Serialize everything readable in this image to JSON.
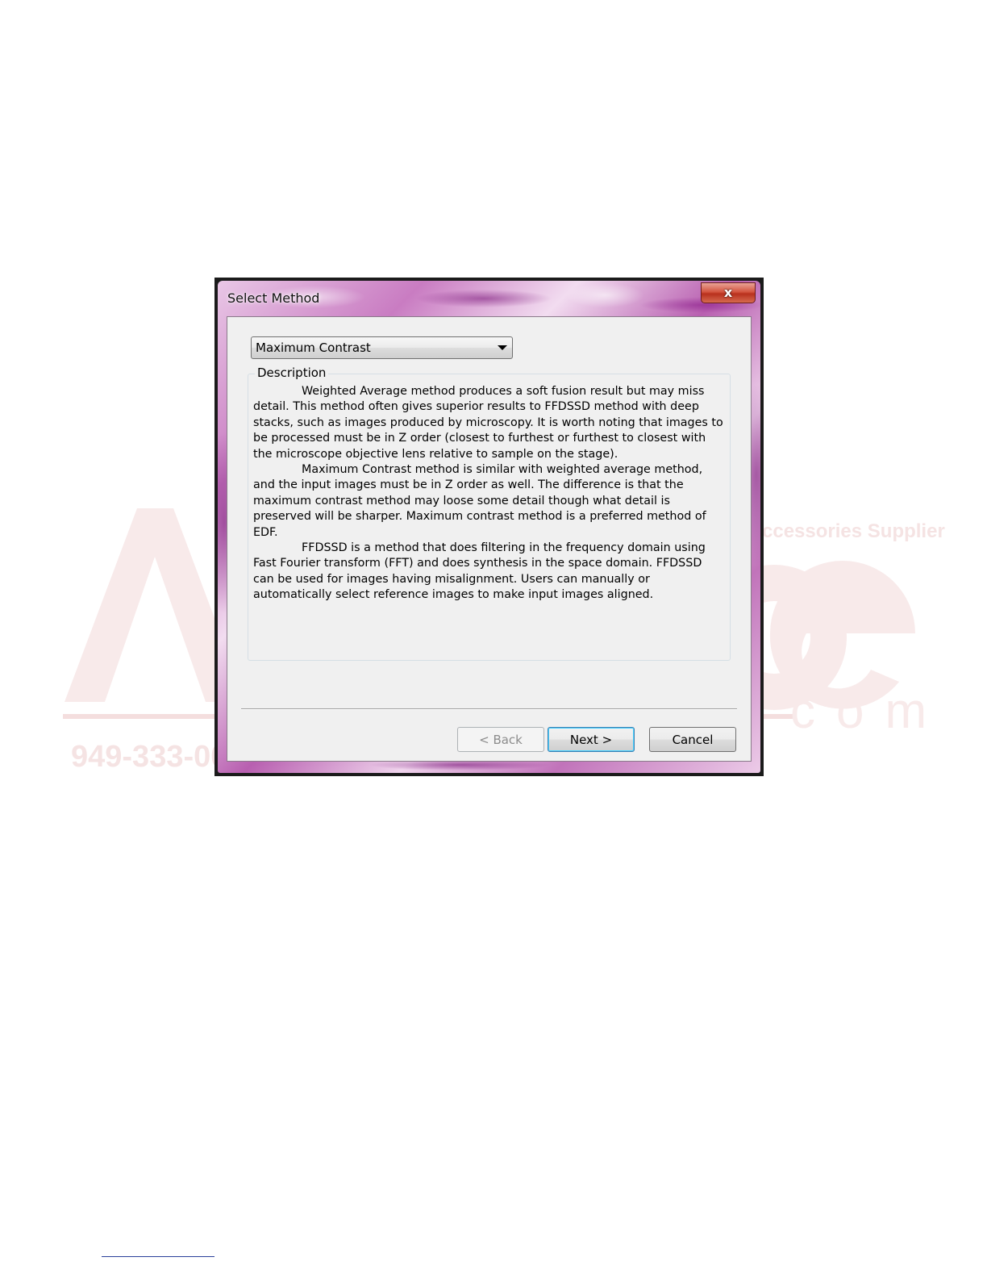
{
  "dialog": {
    "title": "Select Method",
    "close_label": "x"
  },
  "method_select": {
    "value": "Maximum Contrast"
  },
  "description": {
    "legend": "Description",
    "paragraphs": [
      "Weighted Average method produces a soft fusion result but may miss detail. This method often gives superior results to FFDSSD method with deep stacks, such as images produced by microscopy. It is worth noting that images to be processed must be in Z order (closest to furthest or furthest to closest with the microscope objective lens relative to sample on the stage).",
      "Maximum Contrast method is similar with weighted average method, and the input images must be in Z order as well. The difference is that the maximum contrast method may loose some detail though what detail is preserved will be sharper. Maximum contrast method is a preferred method of EDF.",
      "FFDSSD is a method that does filtering in the frequency domain using Fast Fourier transform (FFT) and does synthesis in the space domain. FFDSSD can be used for images having misalignment. Users can manually or automatically select reference images to make input images aligned."
    ]
  },
  "buttons": {
    "back": "< Back",
    "next": "Next >",
    "cancel": "Cancel"
  },
  "watermark": {
    "tagline": "ccessories Supplier",
    "phone": "949-333-00",
    "domain_fragment": "com"
  },
  "colors": {
    "watermark_red": "#f4dede",
    "dialog_client": "#f0f0f0",
    "close_red": "#c8402c",
    "focus_blue": "#3c7fb1"
  }
}
